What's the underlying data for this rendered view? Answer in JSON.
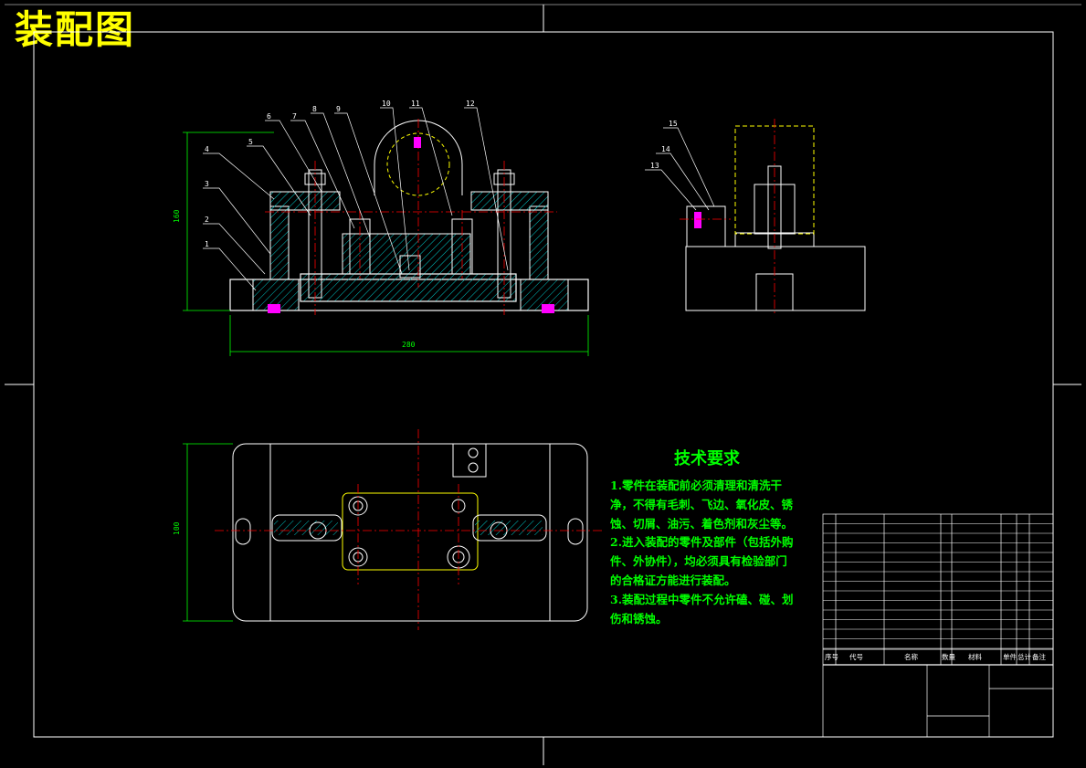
{
  "drawing": {
    "title": "装配图",
    "dimensions": {
      "height_front": "160",
      "width_front": "280",
      "height_plan": "100"
    },
    "part_numbers_front": [
      "1",
      "2",
      "3",
      "4",
      "5",
      "6",
      "7",
      "8",
      "9",
      "10",
      "11",
      "12"
    ],
    "part_numbers_side": [
      "13",
      "14",
      "15"
    ]
  },
  "technical_requirements": {
    "heading": "技术要求",
    "lines": [
      "1.零件在装配前必须清理和清洗干",
      "净，不得有毛刺、飞边、氧化皮、锈",
      "蚀、切屑、油污、着色剂和灰尘等。",
      "2.进入装配的零件及部件（包括外购",
      "件、外协件），均必须具有检验部门",
      "的合格证方能进行装配。",
      "3.装配过程中零件不允许磕、碰、划",
      "伤和锈蚀。"
    ]
  },
  "parts_list": {
    "header": [
      "序号",
      "代号",
      "名称",
      "数量",
      "材料",
      "单件",
      "总计",
      "备注"
    ]
  },
  "colors": {
    "background": "#000000",
    "outline": "#ffffff",
    "center": "#ff0000",
    "hatch": "#00c8c8",
    "dimension": "#00ff00",
    "highlight": "#ffff00",
    "pin": "#ff00ff"
  }
}
